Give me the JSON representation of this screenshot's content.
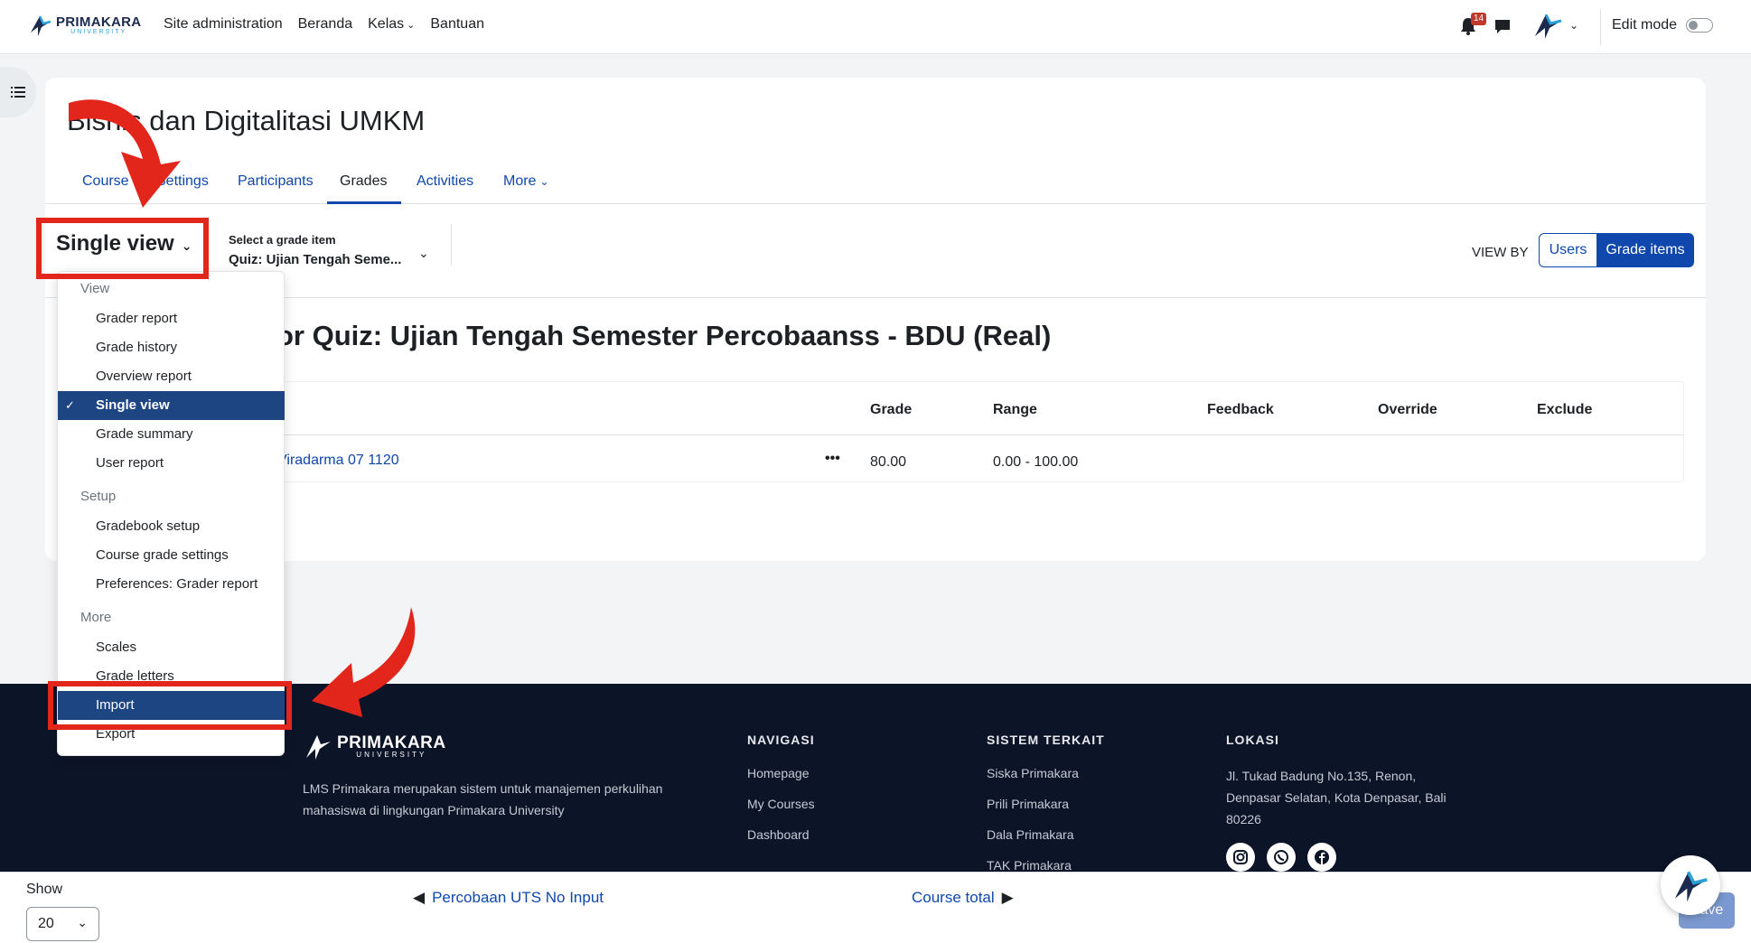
{
  "navbar": {
    "logo_text": "PRIMAKARA",
    "logo_sub": "UNIVERSITY",
    "links": [
      "Site administration",
      "Beranda",
      "Kelas",
      "Bantuan"
    ],
    "notification_count": "14",
    "edit_mode_label": "Edit mode"
  },
  "course": {
    "title": "Bisnis dan Digitalitasi UMKM",
    "tabs": [
      "Course",
      "Settings",
      "Participants",
      "Grades",
      "Activities",
      "More"
    ],
    "active_tab": "Grades"
  },
  "tertiary": {
    "report_select": "Single view",
    "grade_item_label": "Select a grade item",
    "grade_item_value": "Quiz: Ujian Tengah Seme...",
    "view_by_label": "VIEW BY",
    "view_by_users": "Users",
    "view_by_grade_items": "Grade items"
  },
  "section_heading": "or Quiz: Ujian Tengah Semester Percobaanss - BDU (Real)",
  "table": {
    "headers": [
      "Grade",
      "Range",
      "Feedback",
      "Override",
      "Exclude"
    ],
    "rows": [
      {
        "name": "Viradarma 07 1120",
        "menu": "•••",
        "grade": "80.00",
        "range": "0.00 - 100.00"
      }
    ]
  },
  "dropdown": {
    "groups": [
      {
        "label": "View",
        "items": [
          "Grader report",
          "Grade history",
          "Overview report",
          "Single view",
          "Grade summary",
          "User report"
        ]
      },
      {
        "label": "Setup",
        "items": [
          "Gradebook setup",
          "Course grade settings",
          "Preferences: Grader report"
        ]
      },
      {
        "label": "More",
        "items": [
          "Scales",
          "Grade letters",
          "Import",
          "Export"
        ]
      }
    ],
    "selected": "Single view",
    "highlighted": "Import"
  },
  "footer": {
    "logo_text": "PRIMAKARA",
    "logo_sub": "UNIVERSITY",
    "description": "LMS Primakara merupakan sistem untuk manajemen perkulihan mahasiswa di lingkungan Primakara University",
    "navigasi_title": "NAVIGASI",
    "navigasi": [
      "Homepage",
      "My Courses",
      "Dashboard"
    ],
    "sistem_title": "SISTEM TERKAIT",
    "sistem": [
      "Siska Primakara",
      "Prili Primakara",
      "Dala Primakara",
      "TAK Primakara"
    ],
    "lokasi_title": "LOKASI",
    "address": "Jl. Tukad Badung No.135, Renon, Denpasar Selatan, Kota Denpasar, Bali 80226",
    "socials": [
      "instagram-icon",
      "whatsapp-icon",
      "facebook-icon"
    ]
  },
  "sticky": {
    "show_label": "Show",
    "show_value": "20",
    "prev_label": "Percobaan UTS No Input",
    "next_label": "Course total",
    "save_label": "Save"
  },
  "colors": {
    "primary": "#0f47ad",
    "footer_bg": "#0c1428",
    "dropdown_active": "#1c4582",
    "annotation_red": "#e3261c"
  }
}
